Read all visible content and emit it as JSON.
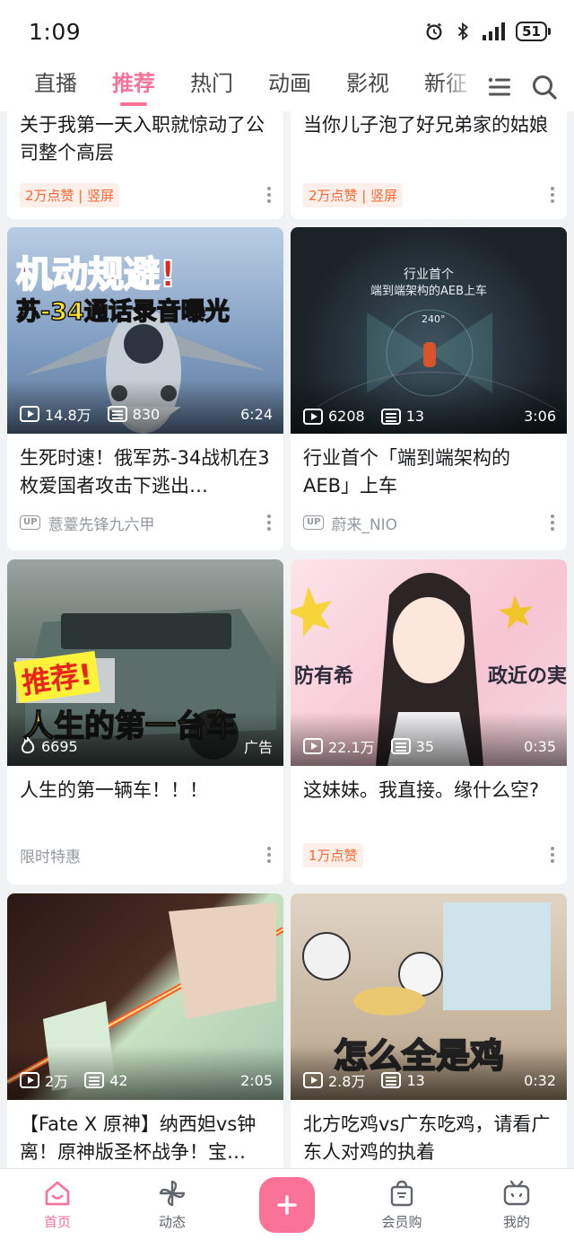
{
  "status": {
    "time": "1:09",
    "battery": "51"
  },
  "tabs": [
    {
      "label": "直播"
    },
    {
      "label": "推荐",
      "active": true
    },
    {
      "label": "热门"
    },
    {
      "label": "动画"
    },
    {
      "label": "影视"
    },
    {
      "label": "新征"
    }
  ],
  "cards": [
    {
      "title": "关于我第一天入职就惊动了公司整个高层",
      "tag": "2万点赞 | 竖屏"
    },
    {
      "title": "当你儿子泡了好兄弟家的姑娘",
      "tag": "2万点赞 | 竖屏"
    },
    {
      "title": "生死时速！俄军苏-34战机在3枚爱国者攻击下逃出…",
      "views": "14.8万",
      "danmaku": "830",
      "duration": "6:24",
      "up": "薏薹先锋九六甲",
      "overlay1": "机动规避!",
      "overlay2": "苏-34通话录音曝光"
    },
    {
      "title": "行业首个「端到端架构的AEB」上车",
      "views": "6208",
      "danmaku": "13",
      "duration": "3:06",
      "up": "蔚来_NIO",
      "overlay1": "行业首个",
      "overlay2": "端到端架构的AEB上车",
      "overlay3": "240°"
    },
    {
      "title": "人生的第一辆车！！！",
      "views": "6695",
      "duration": "广告",
      "sub": "限时特惠",
      "overlay1": "推荐!",
      "overlay2": "人生的第一台车"
    },
    {
      "title": "这妹妹。我直接。缘什么空?",
      "views": "22.1万",
      "danmaku": "35",
      "duration": "0:35",
      "tag": "1万点赞",
      "overlay1": "防有希",
      "overlay2": "政近の実"
    },
    {
      "title": "【Fate X 原神】纳西妲vs钟离！原神版圣杯战争！宝…",
      "views": "2万",
      "danmaku": "42",
      "duration": "2:05"
    },
    {
      "title": "北方吃鸡vs广东吃鸡，请看广东人对鸡的执着",
      "views": "2.8万",
      "danmaku": "13",
      "duration": "0:32",
      "overlay1": "怎么全是鸡"
    }
  ],
  "nav": [
    {
      "label": "首页",
      "active": true
    },
    {
      "label": "动态"
    },
    {
      "label": ""
    },
    {
      "label": "会员购"
    },
    {
      "label": "我的"
    }
  ],
  "colors": {
    "accent": "#fb7299",
    "tagText": "#ff6633",
    "tagBg": "#fdefe9"
  }
}
